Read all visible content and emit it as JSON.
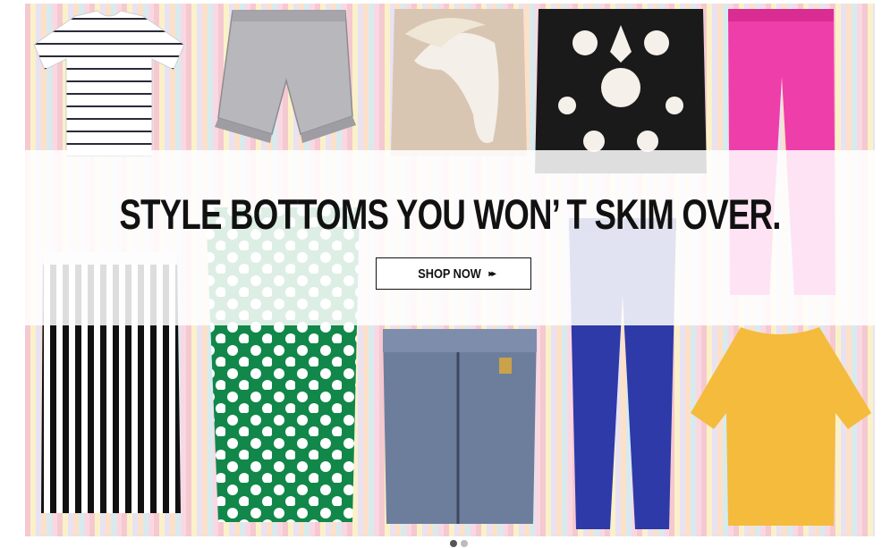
{
  "banner": {
    "headline": "STYLE BOTTOMS    YOU WON’    T SKIM OVER.",
    "cta_label": "SHOP NOW",
    "cta_arrow": "▸▸",
    "garments": [
      {
        "name": "striped-tshirt",
        "color": "#ffffff"
      },
      {
        "name": "acid-wash-shorts",
        "color": "#b8b8bc"
      },
      {
        "name": "horse-print-skirt",
        "color": "#d8c6b2"
      },
      {
        "name": "baroque-print-shorts",
        "color": "#1a1a1a"
      },
      {
        "name": "pink-trousers",
        "color": "#ee3ea9"
      },
      {
        "name": "striped-pencil-skirt",
        "color": "#111111"
      },
      {
        "name": "polka-dot-skirt",
        "color": "#12874a"
      },
      {
        "name": "denim-zip-skirt",
        "color": "#6d7e9c"
      },
      {
        "name": "blue-trousers",
        "color": "#2d3aa8"
      },
      {
        "name": "yellow-top",
        "color": "#f4bb3c"
      }
    ]
  },
  "carousel": {
    "slides": 2,
    "active": 1
  }
}
